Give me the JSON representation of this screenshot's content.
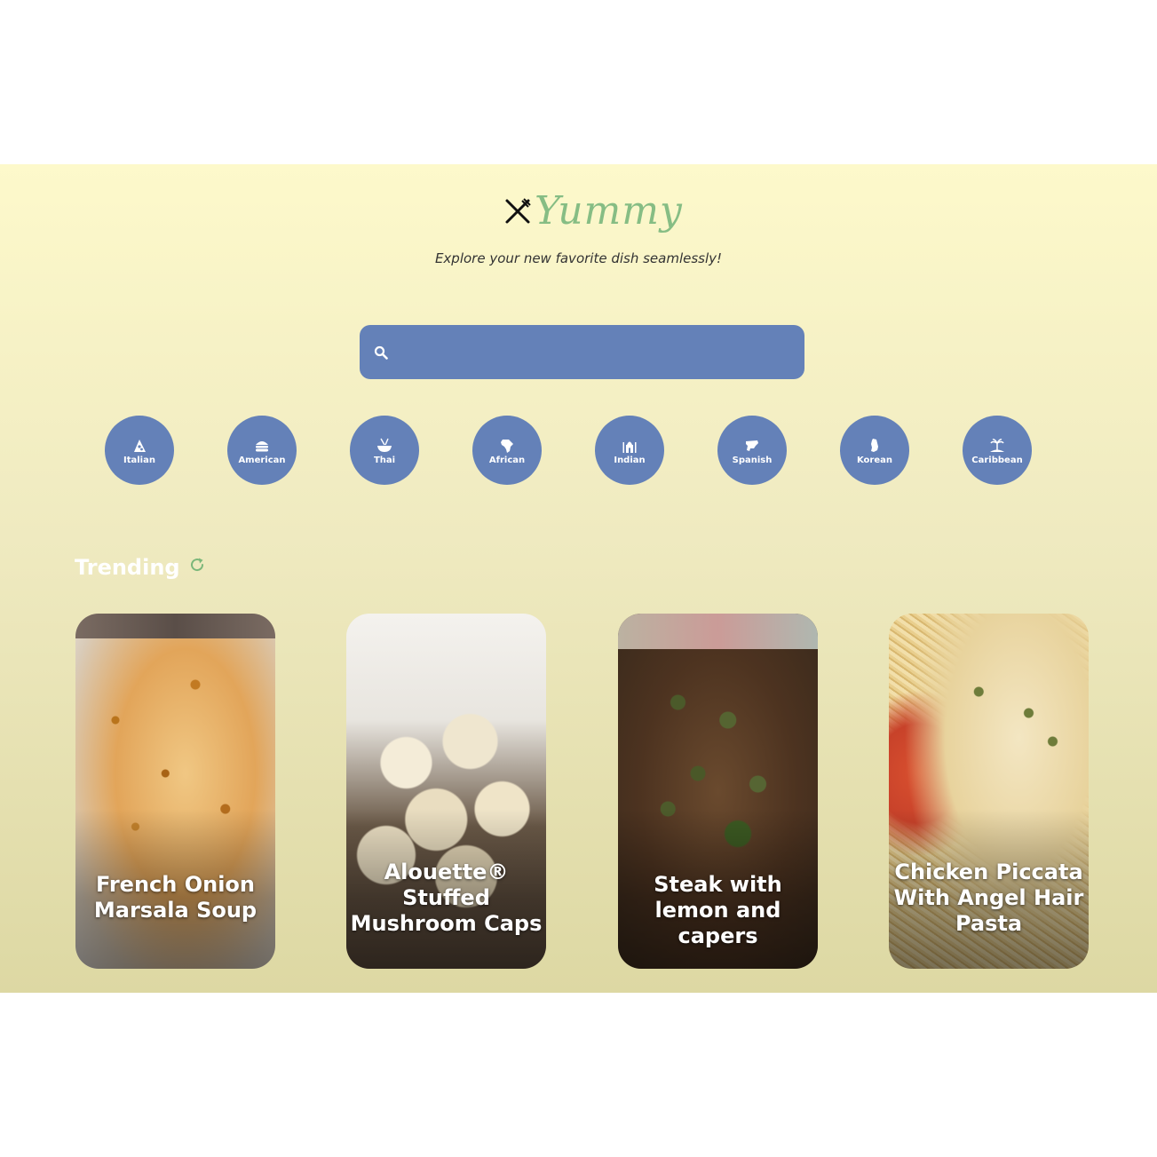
{
  "header": {
    "logo_text": "Yummy",
    "tagline": "Explore your new favorite dish seamlessly!"
  },
  "search": {
    "placeholder": "",
    "value": ""
  },
  "cuisines": [
    {
      "label": "Italian",
      "icon": "pizza-icon"
    },
    {
      "label": "American",
      "icon": "hamburger-icon"
    },
    {
      "label": "Thai",
      "icon": "noodle-bowl-icon"
    },
    {
      "label": "African",
      "icon": "africa-map-icon"
    },
    {
      "label": "Indian",
      "icon": "taj-mahal-icon"
    },
    {
      "label": "Spanish",
      "icon": "spain-map-icon"
    },
    {
      "label": "Korean",
      "icon": "korea-map-icon"
    },
    {
      "label": "Caribbean",
      "icon": "island-icon"
    }
  ],
  "trending": {
    "title": "Trending",
    "cards": [
      {
        "title": "French Onion Marsala Soup"
      },
      {
        "title": "Alouette® Stuffed Mushroom Caps"
      },
      {
        "title": "Steak with lemon and capers"
      },
      {
        "title": "Chicken Piccata With Angel Hair Pasta"
      }
    ]
  },
  "colors": {
    "accent_blue": "#6481b8",
    "logo_green": "#86bd84",
    "background_top": "#fdf9cb",
    "background_bottom": "#ddd8a3"
  }
}
